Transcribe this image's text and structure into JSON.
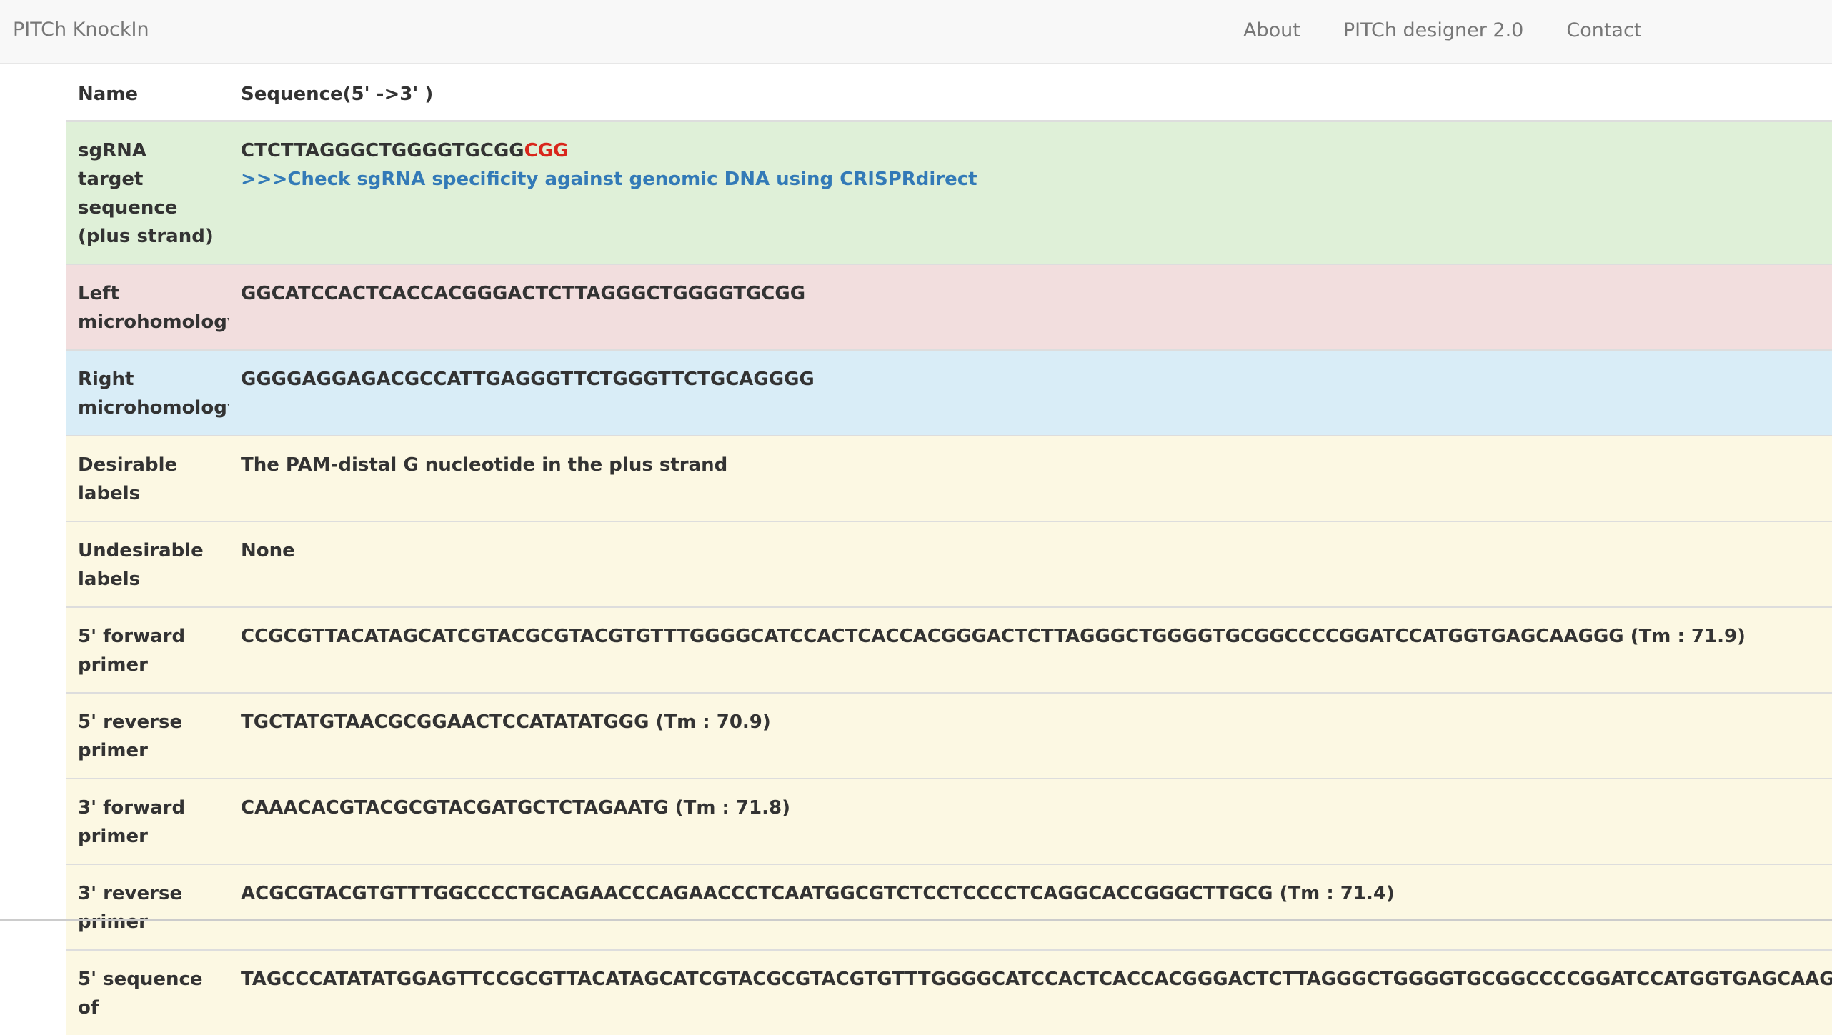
{
  "nav": {
    "brand": "PITCh KnockIn",
    "links": [
      "About",
      "PITCh designer 2.0",
      "Contact"
    ]
  },
  "table": {
    "headers": [
      "Name",
      "Sequence(5' ->3' )"
    ],
    "sgrna": {
      "name": "sgRNA target sequence (plus strand)",
      "sequence": "CTCTTAGGGCTGGGGTGCGG",
      "pam": "CGG",
      "link_text": ">>>Check sgRNA specificity against genomic DNA using CRISPRdirect"
    },
    "left_mh": {
      "name": "Left microhomology",
      "value": "GGCATCCACTCACCACGGGACTCTTAGGGCTGGGGTGCGG"
    },
    "right_mh": {
      "name": "Right microhomology",
      "value": "GGGGAGGAGACGCCATTGAGGGTTCTGGGTTCTGCAGGGG"
    },
    "desirable": {
      "name": "Desirable labels",
      "value": "The PAM-distal G nucleotide in the plus strand"
    },
    "undesirable": {
      "name": "Undesirable labels",
      "value": "None"
    },
    "fwd5": {
      "name": "5'  forward primer",
      "value": "CCGCGTTACATAGCATCGTACGCGTACGTGTTTGGGGCATCCACTCACCACGGGACTCTTAGGGCTGGGGTGCGGCCCCGGATCCATGGTGAGCAAGGG (Tm : 71.9)"
    },
    "rev5": {
      "name": "5'  reverse primer",
      "value": "TGCTATGTAACGCGGAACTCCATATATGGG (Tm : 70.9)"
    },
    "fwd3": {
      "name": "3'  forward primer",
      "value": "CAAACACGTACGCGTACGATGCTCTAGAATG (Tm : 71.8)"
    },
    "rev3": {
      "name": "3'  reverse primer",
      "value": "ACGCGTACGTGTTTGGCCCCTGCAGAACCCAGAACCCTCAATGGCGTCTCCTCCCCTCAGGCACCGGGCTTGCG (Tm : 71.4)"
    },
    "seq5": {
      "name": "5'  sequence of",
      "value": "TAGCCCATATATGGAGTTCCGCGTTACATAGCATCGTACGCGTACGTGTTTGGGGCATCCACTCACCACGGGACTCTTAGGGCTGGGGTGCGGCCCCGGATCCATGGTGAGCAAGGGCGA"
    }
  },
  "colors": {
    "success_row": "#dff0d8",
    "danger_row": "#f2dede",
    "info_row": "#d9edf7",
    "warning_row": "#fcf8e3",
    "pam_red": "#d9261c",
    "link_blue": "#337ab7"
  }
}
